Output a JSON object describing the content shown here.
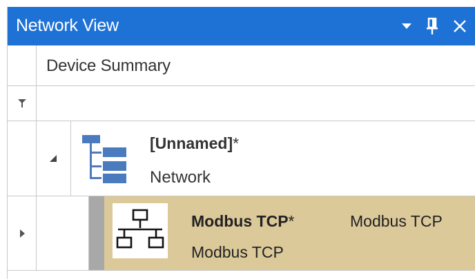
{
  "panel": {
    "title": "Network View",
    "controls": {
      "dropdown_icon": "dropdown-triangle-icon",
      "pin_icon": "pin-icon",
      "close_icon": "close-icon"
    }
  },
  "colors": {
    "titlebar": "#1e72d6",
    "selected_row": "#dcc99a",
    "tree_icon": "#4a7bbf"
  },
  "columns": {
    "device_summary": "Device Summary"
  },
  "filter": {
    "icon": "filter-icon"
  },
  "tree": {
    "network": {
      "name": "[Unnamed]",
      "modified_marker": "*",
      "subtitle": "Network",
      "expander_icon": "expanded-triangle-icon",
      "icon": "network-tree-icon"
    },
    "device": {
      "name": "Modbus TCP",
      "modified_marker": "*",
      "type": "Modbus TCP",
      "subtitle": "Modbus TCP",
      "row_indicator_icon": "row-arrow-icon",
      "icon": "network-topology-icon"
    }
  }
}
